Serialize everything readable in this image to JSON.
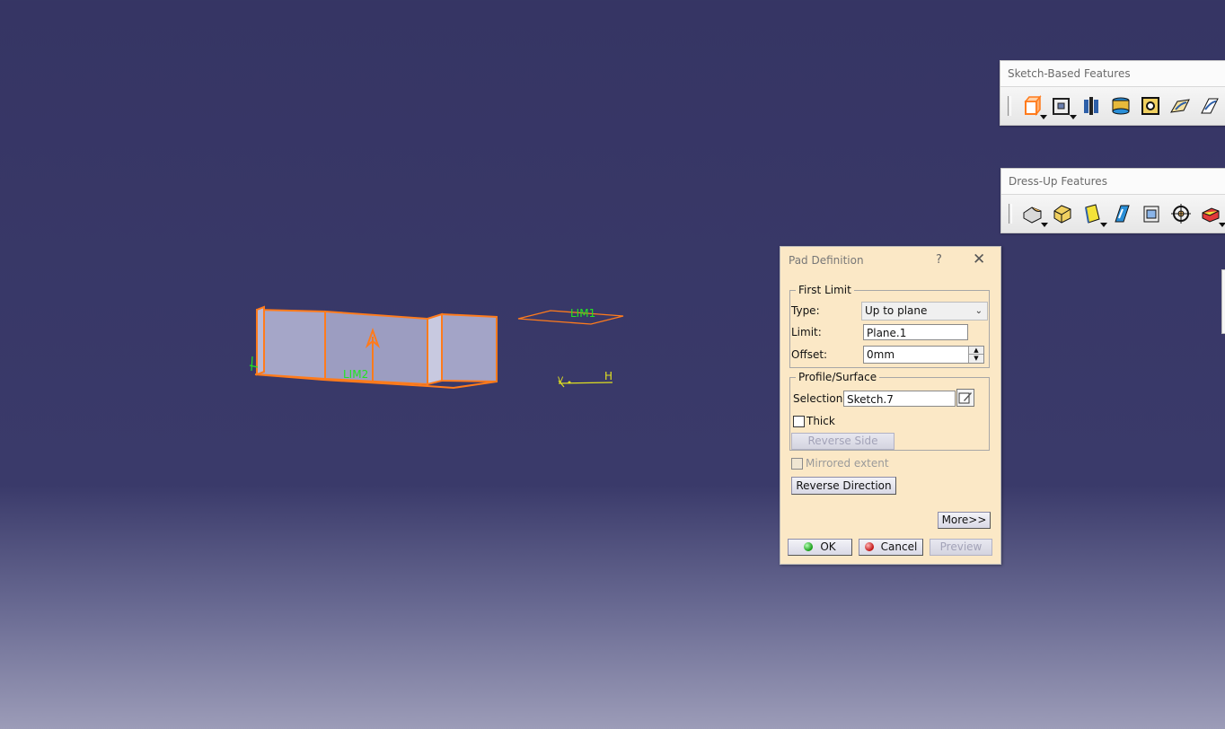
{
  "viewport": {
    "background_top": "#363564",
    "background_bottom": "#9c9cb8",
    "highlight_color": "#ff7b1c",
    "label_color": "#21e521",
    "labels": {
      "lim1": "LIM1",
      "lim2": "LIM2",
      "axis_h": "H",
      "axis_v": "V"
    }
  },
  "toolbars": {
    "sketch_based": {
      "title": "Sketch-Based Features",
      "icons": [
        "pad-icon",
        "pocket-icon",
        "shaft-icon",
        "groove-icon",
        "hole-icon",
        "rib-icon",
        "slot-icon"
      ]
    },
    "dress_up": {
      "title": "Dress-Up Features",
      "icons": [
        "edge-fillet-icon",
        "chamfer-icon",
        "draft-icon",
        "shell-icon",
        "thickness-icon",
        "thread-icon",
        "remove-face-icon"
      ]
    }
  },
  "dialog": {
    "title": "Pad Definition",
    "help": "?",
    "close": "✕",
    "first_limit": {
      "legend": "First Limit",
      "type_label": "Type:",
      "type_value": "Up to plane",
      "limit_label": "Limit:",
      "limit_value": "Plane.1",
      "offset_label": "Offset:",
      "offset_value": "0mm"
    },
    "profile": {
      "legend": "Profile/Surface",
      "selection_label": "Selection:",
      "selection_value": "Sketch.7",
      "thick_label": "Thick",
      "thick_checked": false,
      "reverse_side_label": "Reverse Side"
    },
    "mirrored_label": "Mirrored extent",
    "reverse_direction_label": "Reverse Direction",
    "more_label": "More>>",
    "ok_label": "OK",
    "cancel_label": "Cancel",
    "preview_label": "Preview"
  }
}
